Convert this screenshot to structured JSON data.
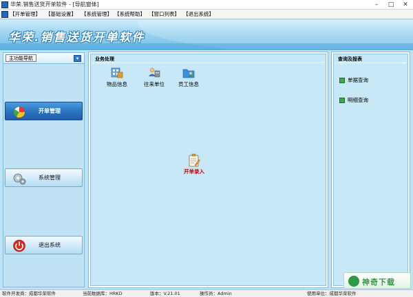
{
  "window": {
    "title": "华荣.销售送货开单软件 - [导航窗体]",
    "controls": [
      "–",
      "□",
      "✕"
    ]
  },
  "menubar": {
    "items": [
      "【开单管理】",
      "【基础设置】",
      "【系统管理】",
      "【系统帮助】",
      "【窗口列表】",
      "【退出系统】"
    ]
  },
  "banner": {
    "title": "华荣.销售送货开单软件"
  },
  "left_nav": {
    "header": "主功能导航",
    "collapse_icon": "arrow-down-icon",
    "buttons": [
      {
        "label": "开单管理",
        "icon": "pie-chart-icon",
        "active": true
      },
      {
        "label": "系统管理",
        "icon": "gears-icon",
        "active": false
      },
      {
        "label": "退出系统",
        "icon": "power-icon",
        "active": false
      }
    ]
  },
  "business": {
    "title": "业务处理",
    "tools": [
      {
        "label": "物品信息",
        "icon": "goods-icon"
      },
      {
        "label": "往来单位",
        "icon": "units-icon"
      },
      {
        "label": "员工信息",
        "icon": "staff-icon"
      }
    ],
    "main_action": {
      "label": "开单录入",
      "icon": "clipboard-pencil-icon"
    }
  },
  "reports": {
    "title": "查询及报表",
    "links": [
      {
        "label": "单据查询",
        "icon": "report-icon"
      },
      {
        "label": "明细查询",
        "icon": "report-icon"
      }
    ]
  },
  "statusbar": {
    "developer": "软件开发商：成都华荣软件",
    "database": "当前数据库：HRKD",
    "version": "版本：V.21.01",
    "operator": "操作员：Admin",
    "user_unit": "使用单位：成都华荣软件"
  },
  "watermark": {
    "text": "神奇下载"
  },
  "colors": {
    "background": "#bfe3f5",
    "active_nav": "#2a72c0",
    "main_action_text": "#c00000",
    "report_icon": "#3fa64f"
  }
}
